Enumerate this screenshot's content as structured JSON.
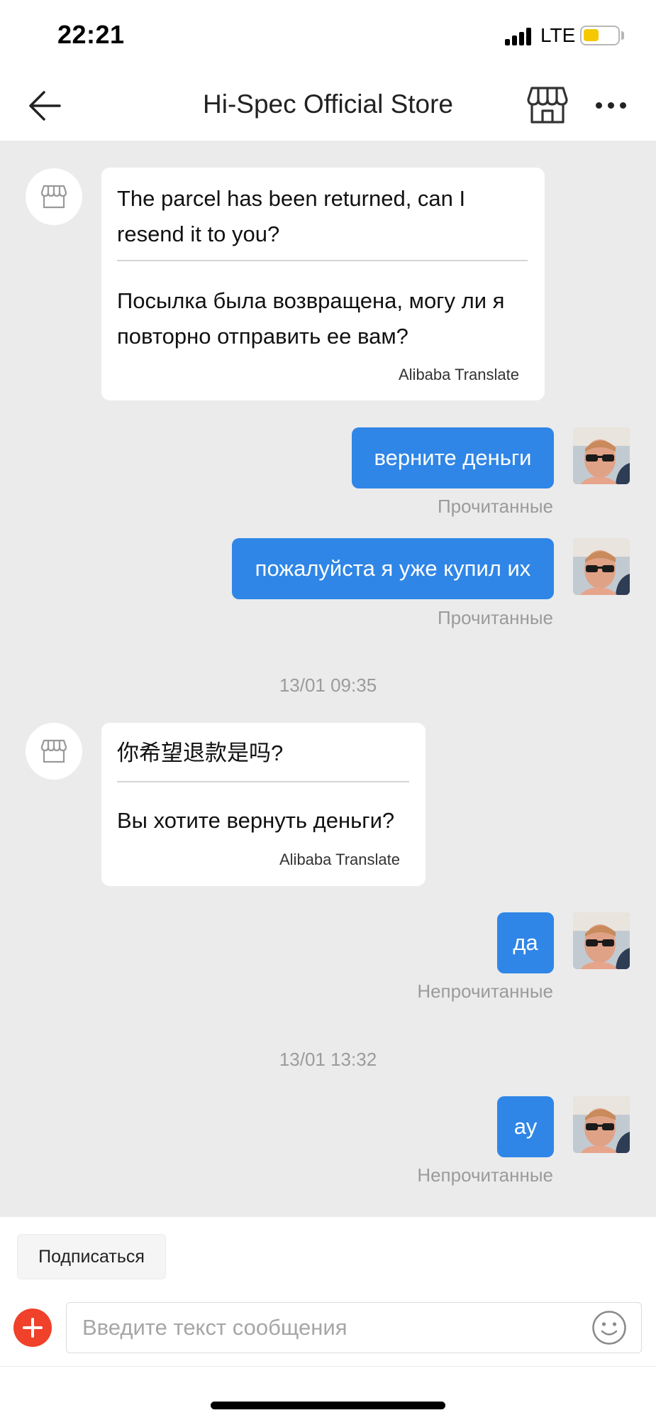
{
  "status_bar": {
    "time": "22:21",
    "network": "LTE",
    "battery_level": 0.45,
    "battery_color": "#f5c800"
  },
  "header": {
    "title": "Hi-Spec Official Store",
    "back_icon": "arrow-left-icon",
    "store_icon": "store-icon",
    "more_icon": "more-horizontal-icon"
  },
  "messages": [
    {
      "direction": "incoming",
      "original": "The parcel has been returned, can I resend it to you?",
      "translation": "Посылка была возвращена, могу ли я повторно отправить ее вам?",
      "credit": "Alibaba Translate"
    },
    {
      "direction": "outgoing",
      "text": "верните деньги",
      "status": "Прочитанные"
    },
    {
      "direction": "outgoing",
      "text": "пожалуйста я уже купил их",
      "status": "Прочитанные"
    },
    {
      "type": "timestamp",
      "text": "13/01 09:35"
    },
    {
      "direction": "incoming",
      "original": "你希望退款是吗?",
      "translation": "Вы хотите вернуть деньги?",
      "credit": "Alibaba Translate"
    },
    {
      "direction": "outgoing",
      "text": "да",
      "status": "Непрочитанные"
    },
    {
      "type": "timestamp",
      "text": "13/01 13:32"
    },
    {
      "direction": "outgoing",
      "text": "ау",
      "status": "Непрочитанные"
    }
  ],
  "bottom": {
    "subscribe_label": "Подписаться",
    "input_placeholder": "Введите текст сообщения",
    "input_value": "",
    "plus_icon": "plus-circle-icon",
    "emoji_icon": "smiley-icon"
  },
  "colors": {
    "outgoing_bubble": "#2f86e6",
    "chat_background": "#ebebeb",
    "plus_button": "#f0412a"
  }
}
